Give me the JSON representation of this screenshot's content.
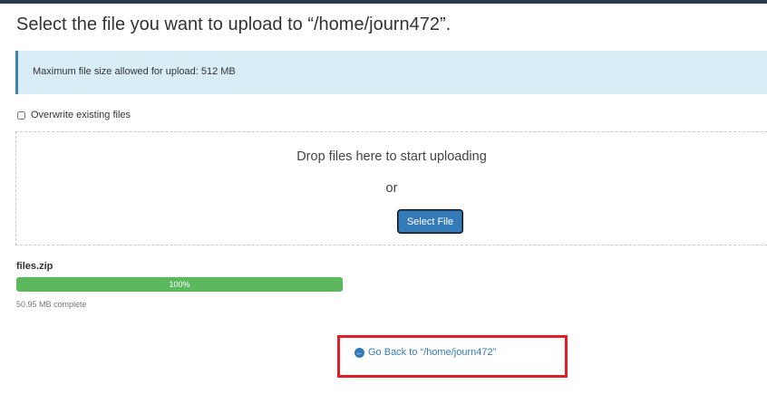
{
  "page": {
    "title": "Select the file you want to upload to “/home/journ472”."
  },
  "info": {
    "text": "Maximum file size allowed for upload: 512 MB"
  },
  "options": {
    "overwrite_label": "Overwrite existing files",
    "overwrite_checked": false
  },
  "dropzone": {
    "drop_text": "Drop files here to start uploading",
    "or_text": "or",
    "select_button": "Select File"
  },
  "upload": {
    "file_name": "files.zip",
    "progress": 1.0,
    "progress_label": "100%",
    "status": "50.95 MB complete"
  },
  "footer": {
    "back_icon": "arrow-circle-left-icon",
    "back_label": "Go Back to “/home/journ472”"
  },
  "colors": {
    "accent": "#337ab7",
    "progress": "#5cb85c",
    "info_bg": "#d9edf7",
    "highlight": "#e21d25"
  }
}
